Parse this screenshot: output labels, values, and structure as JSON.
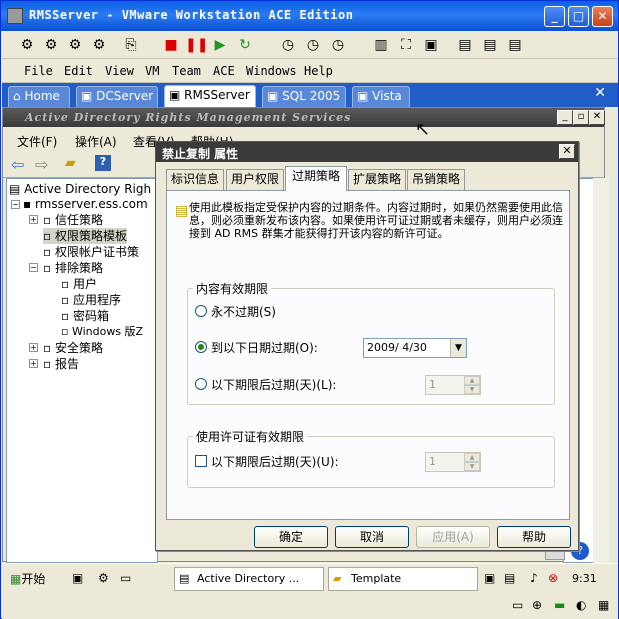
{
  "window": {
    "title": "RMSServer - VMware Workstation ACE Edition"
  },
  "menu": [
    "File",
    "Edit",
    "View",
    "VM",
    "Team",
    "ACE",
    "Windows",
    "Help"
  ],
  "tabs": [
    {
      "label": "Home",
      "icon": "home-icon"
    },
    {
      "label": "DCServer",
      "icon": "vm-icon"
    },
    {
      "label": "RMSServer",
      "icon": "vm-icon"
    },
    {
      "label": "SQL 2005",
      "icon": "vm-icon"
    },
    {
      "label": "Vista",
      "icon": "vm-icon"
    }
  ],
  "guest": {
    "mmc_title": "Active Directory Rights Management Services",
    "menu": [
      "文件(F)",
      "操作(A)",
      "查看(V)",
      "帮助(H)"
    ],
    "tree": [
      {
        "label": "Active Directory Righ"
      },
      {
        "label": "rmsserver.ess.com"
      },
      {
        "label": "信任策略"
      },
      {
        "label": "权限策略模板"
      },
      {
        "label": "权限帐户证书策"
      },
      {
        "label": "排除策略"
      },
      {
        "label": "用户"
      },
      {
        "label": "应用程序"
      },
      {
        "label": "密码箱"
      },
      {
        "label": "Windows 版Z"
      },
      {
        "label": "安全策略"
      },
      {
        "label": "报告"
      }
    ]
  },
  "dialog": {
    "title": "禁止复制 属性",
    "tabs": [
      "标识信息",
      "用户权限",
      "过期策略",
      "扩展策略",
      "吊销策略"
    ],
    "description": "使用此模板指定受保护内容的过期条件。内容过期时，如果仍然需要使用此信息，则必须重新发布该内容。如果使用许可证过期或者未缓存，则用户必须连接到 AD RMS 群集才能获得打开该内容的新许可证。",
    "content_group": {
      "label": "内容有效期限",
      "opt_never": "永不过期(S)",
      "opt_date": "到以下日期过期(O):",
      "date_value": "2009/ 4/30",
      "opt_days": "以下期限后过期(天)(L):",
      "days_value": "1"
    },
    "license_group": {
      "label": "使用许可证有效期限",
      "opt_days": "以下期限后过期(天)(U):",
      "days_value": "1"
    },
    "buttons": {
      "ok": "确定",
      "cancel": "取消",
      "apply": "应用(A)",
      "help": "帮助"
    }
  },
  "taskbar": {
    "start": "开始",
    "tasks": [
      {
        "label": "Active Directory ..."
      },
      {
        "label": "Template"
      }
    ],
    "clock": "9:31"
  }
}
